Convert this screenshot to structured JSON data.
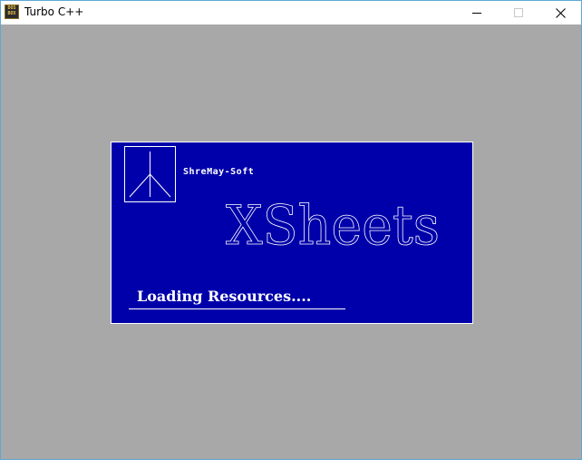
{
  "window": {
    "title": "Turbo C++",
    "icon": "dosbox-icon",
    "icon_text_top": "DOS",
    "icon_text_bottom": "BOX"
  },
  "titlebar_buttons": {
    "minimize": "minimize-icon",
    "maximize": "maximize-icon",
    "close": "close-icon"
  },
  "splash": {
    "brand": "ShreMay-Soft",
    "product": "XSheets",
    "status": "Loading Resources....",
    "logo_icon": "tripod-logo-icon"
  },
  "colors": {
    "desktop_bg": "#a8a8a8",
    "splash_bg": "#0000aa",
    "text": "#ffffff",
    "window_border": "#5fa9d6"
  }
}
